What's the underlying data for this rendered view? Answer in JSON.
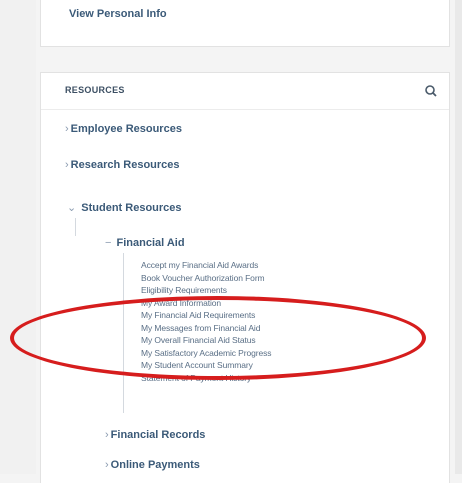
{
  "personal": {
    "view_link": "View Personal Info"
  },
  "resources": {
    "title": "RESOURCES",
    "search_icon": "search-icon",
    "items": {
      "employee": "Employee Resources",
      "research": "Research Resources",
      "student": "Student Resources",
      "financial_aid": "Financial Aid",
      "financial_records": "Financial Records",
      "online_payments": "Online Payments"
    },
    "financial_aid_links": [
      "Accept my Financial Aid Awards",
      "Book Voucher Authorization Form",
      "Eligibility Requirements",
      "My Award Information",
      "My Financial Aid Requirements",
      "My Messages from Financial Aid",
      "My Overall Financial Aid Status",
      "My Satisfactory Academic Progress",
      "My Student Account Summary",
      "Statement of Payment History"
    ]
  },
  "colors": {
    "annotation": "#d61d1d",
    "link": "#3b5a78"
  }
}
